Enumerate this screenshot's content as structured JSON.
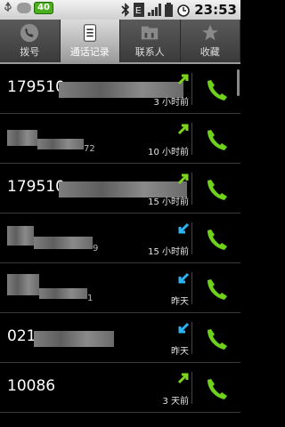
{
  "status_bar": {
    "badge_text": "40",
    "clock": "23:53",
    "icons": [
      "usb-icon",
      "cloud-icon",
      "bluetooth-icon",
      "edge-network-icon",
      "signal-icon",
      "battery-icon",
      "alarm-icon"
    ]
  },
  "tabs": [
    {
      "label": "拨号",
      "icon": "phone-icon"
    },
    {
      "label": "通话记录",
      "icon": "call-log-icon"
    },
    {
      "label": "联系人",
      "icon": "contacts-icon"
    },
    {
      "label": "收藏",
      "icon": "star-icon"
    }
  ],
  "calls": [
    {
      "number": "179510",
      "suffix": "",
      "time": "3 小时前",
      "direction": "outgoing"
    },
    {
      "number": "",
      "suffix": "72",
      "time": "10 小时前",
      "direction": "outgoing"
    },
    {
      "number": "179510",
      "suffix": "",
      "time": "15 小时前",
      "direction": "outgoing"
    },
    {
      "number": "",
      "suffix": "9",
      "time": "15 小时前",
      "direction": "incoming"
    },
    {
      "number": "",
      "suffix": "1",
      "time": "昨天",
      "direction": "incoming"
    },
    {
      "number": "021",
      "suffix": "",
      "time": "昨天",
      "direction": "incoming"
    },
    {
      "number": "10086",
      "suffix": "",
      "time": "3 天前",
      "direction": "outgoing"
    }
  ],
  "colors": {
    "outgoing_arrow": "#7ed321",
    "incoming_arrow": "#29b6f6",
    "call_button": "#6fd11a"
  }
}
